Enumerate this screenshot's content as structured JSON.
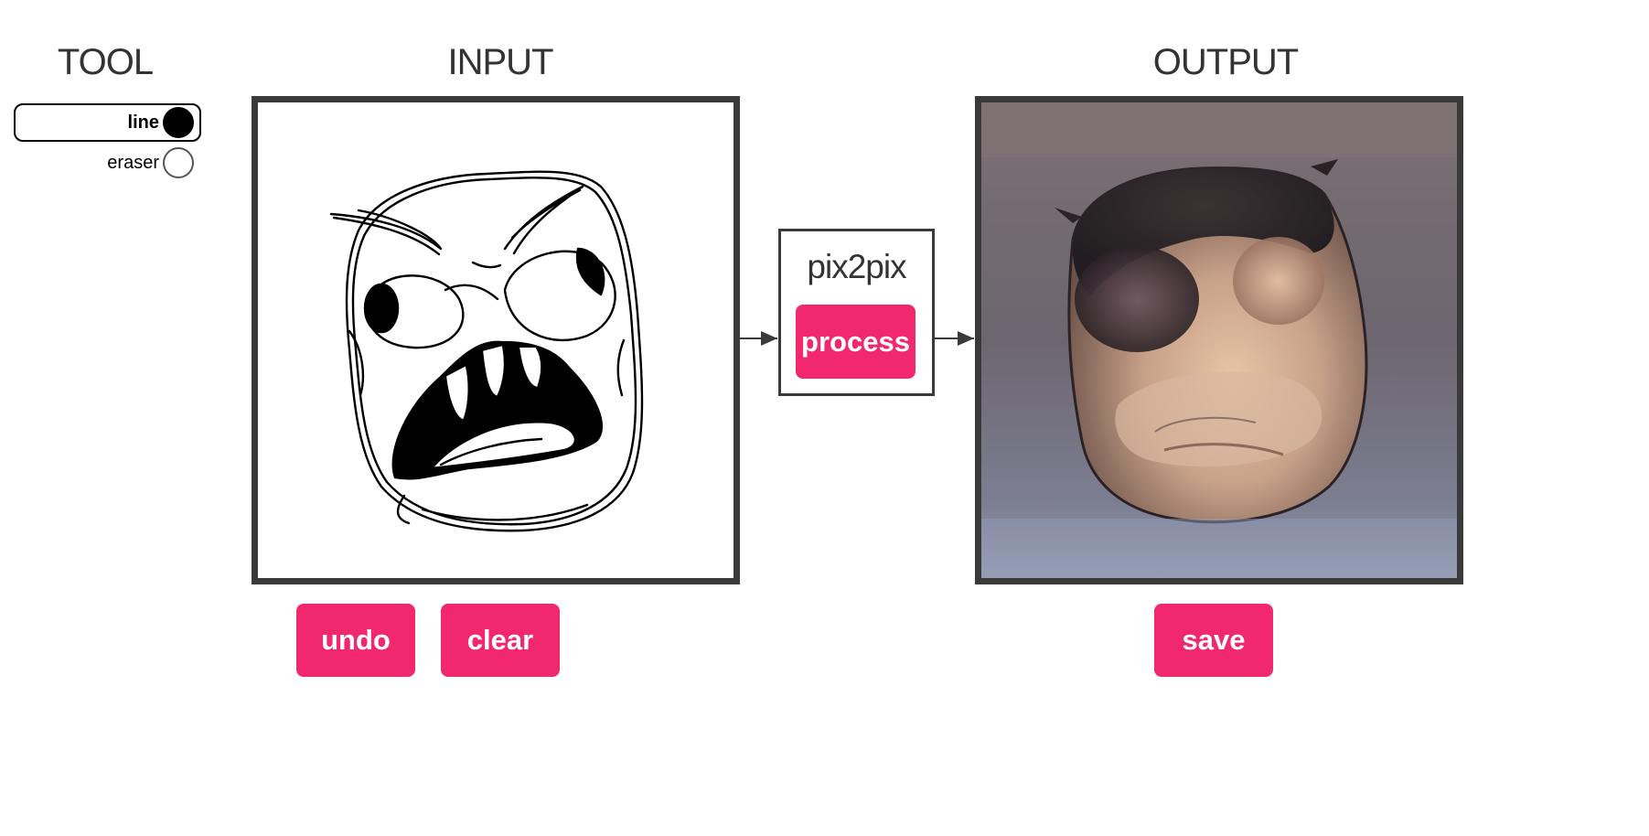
{
  "tool": {
    "title": "TOOL",
    "options": [
      {
        "label": "line",
        "selected": true
      },
      {
        "label": "eraser",
        "selected": false
      }
    ]
  },
  "input": {
    "title": "INPUT",
    "undo_label": "undo",
    "clear_label": "clear"
  },
  "model": {
    "title": "pix2pix",
    "process_label": "process"
  },
  "output": {
    "title": "OUTPUT",
    "save_label": "save"
  },
  "colors": {
    "accent": "#f2286f",
    "frame": "#3a3a3a",
    "text": "#333333"
  }
}
